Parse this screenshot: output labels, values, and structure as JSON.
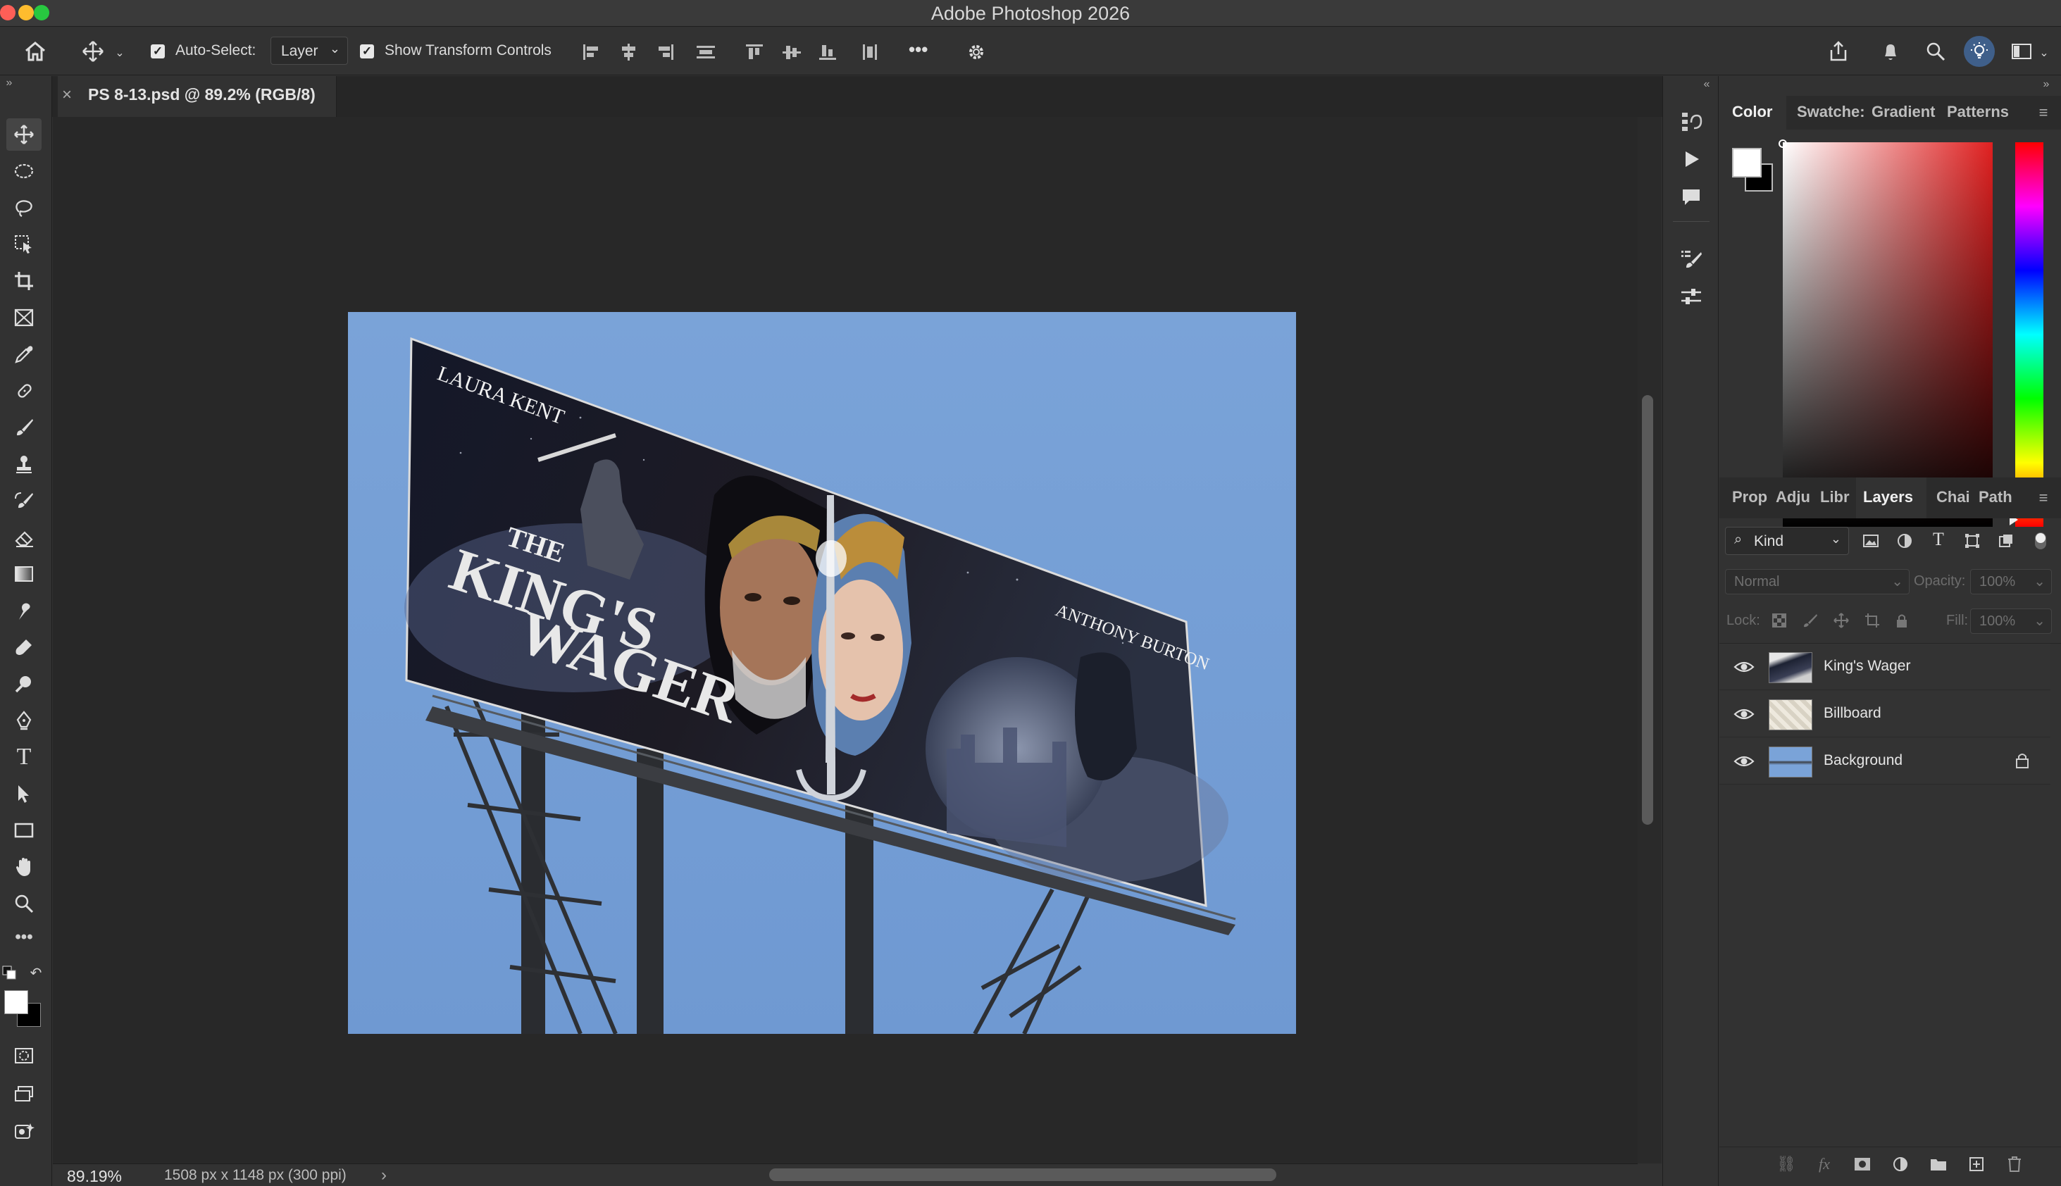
{
  "app": {
    "title": "Adobe Photoshop 2026"
  },
  "options_bar": {
    "auto_select_label": "Auto-Select:",
    "auto_select_value": "Layer",
    "show_transform_label": "Show Transform Controls",
    "more_label": "•••"
  },
  "document": {
    "tab_title": "PS 8-13.psd @ 89.2% (RGB/8)",
    "zoom": "89.19%",
    "dimensions": "1508 px x 1148 px (300 ppi)"
  },
  "artwork": {
    "left_name": "LAURA KENT",
    "right_name": "ANTHONY BURTON",
    "title_1": "THE",
    "title_2": "KING'S",
    "title_3": "WAGER",
    "sky_color": "#7aa3d8"
  },
  "color_panel": {
    "tabs": [
      "Color",
      "Swatches",
      "Gradient",
      "Patterns"
    ],
    "tab_display": [
      "Color",
      "Swatche:",
      "Gradient",
      "Patterns"
    ],
    "active_tab": "Color",
    "foreground": "#ffffff",
    "background": "#000000",
    "hue": "#e02020"
  },
  "layers_panel": {
    "tabs": [
      "Prop",
      "Adju",
      "Libra",
      "Layers",
      "Char",
      "Path"
    ],
    "tab_display": [
      "Prop",
      "Adju",
      "Libr",
      "Layers",
      "Chai",
      "Path"
    ],
    "active_tab": "Layers",
    "filter_label": "Kind",
    "blend_mode": "Normal",
    "opacity_label": "Opacity:",
    "opacity_value": "100%",
    "lock_label": "Lock:",
    "fill_label": "Fill:",
    "fill_value": "100%",
    "layers": [
      {
        "name": "King's Wager",
        "visible": true,
        "locked": false
      },
      {
        "name": "Billboard",
        "visible": true,
        "locked": false
      },
      {
        "name": "Background",
        "visible": true,
        "locked": true
      }
    ]
  }
}
